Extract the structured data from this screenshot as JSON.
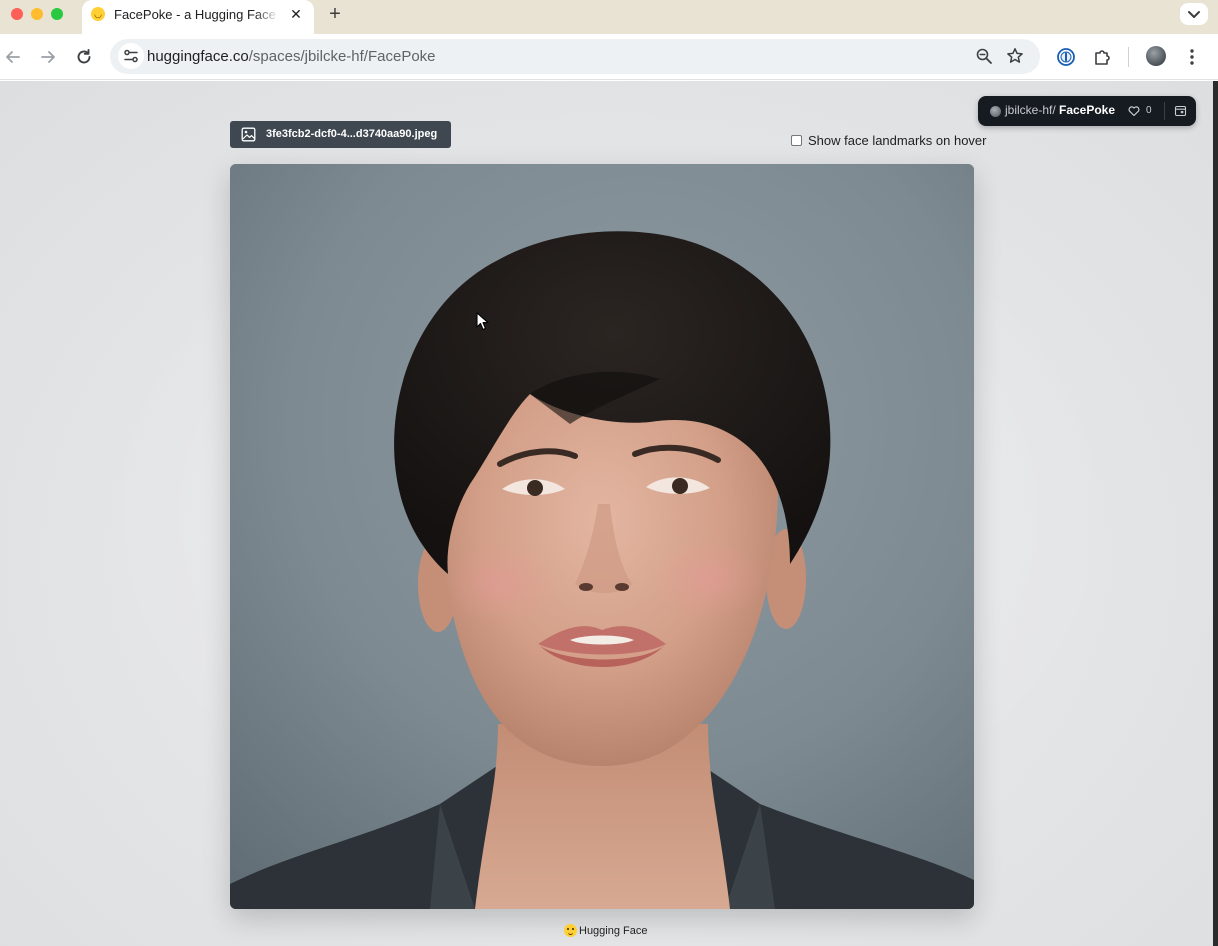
{
  "browser": {
    "tab": {
      "title": "FacePoke - a Hugging Face Space by jbilcke-hf",
      "close_glyph": "✕"
    },
    "new_tab_glyph": "+",
    "url_host": "huggingface.co",
    "url_path": "/spaces/jbilcke-hf/FacePoke"
  },
  "space_badge": {
    "owner": "jbilcke-hf",
    "separator": "/",
    "name": "FacePoke",
    "likes": "0"
  },
  "upload": {
    "filename": "3fe3fcb2-dcf0-4...d3740aa90.jpeg"
  },
  "options": {
    "landmarks_label": "Show face landmarks on hover",
    "landmarks_checked": false
  },
  "footer": {
    "label": "Hugging Face"
  },
  "colors": {
    "tabbar": "#e8e3d3",
    "badge_bg": "#161a21",
    "chip_bg": "#3f4851",
    "page_bg": "#e4e5e7"
  }
}
